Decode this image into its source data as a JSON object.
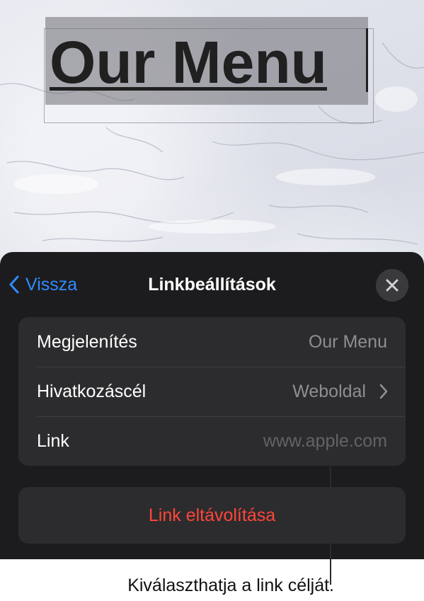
{
  "document": {
    "title_text": "Our Menu"
  },
  "sheet": {
    "back_label": "Vissza",
    "title": "Linkbeállítások",
    "rows": [
      {
        "label": "Megjelenítés",
        "value": "Our Menu"
      },
      {
        "label": "Hivatkozáscél",
        "value": "Weboldal"
      },
      {
        "label": "Link",
        "value": "www.apple.com"
      }
    ],
    "remove_label": "Link eltávolítása"
  },
  "callout": {
    "text": "Kiválaszthatja a link célját."
  },
  "colors": {
    "accent": "#2f8cff",
    "destructive": "#ff453a",
    "sheet_background": "#1c1c1e",
    "group_background": "#2c2c2e"
  },
  "icons": {
    "back": "chevron-left-icon",
    "close": "close-icon",
    "disclosure": "chevron-right-icon"
  }
}
